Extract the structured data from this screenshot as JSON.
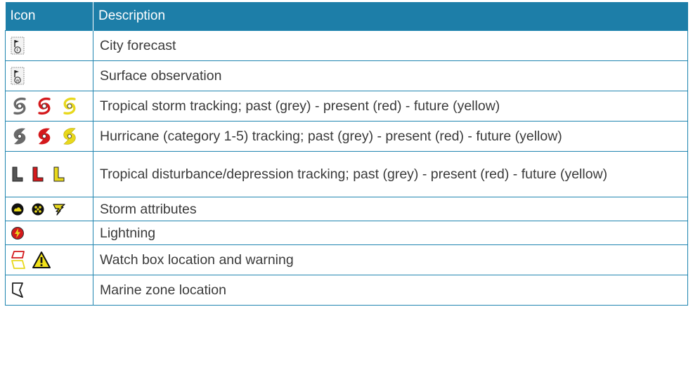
{
  "table": {
    "headers": {
      "icon": "Icon",
      "description": "Description"
    },
    "rows": [
      {
        "description": "City forecast",
        "icons": [
          "city-forecast-flag-icon"
        ]
      },
      {
        "description": "Surface observation",
        "icons": [
          "surface-observation-flag-icon"
        ]
      },
      {
        "description": "Tropical storm tracking; past (grey) - present (red) - future (yellow)",
        "icons": [
          "tropical-storm-grey-icon",
          "tropical-storm-red-icon",
          "tropical-storm-yellow-icon"
        ]
      },
      {
        "description": "Hurricane (category 1-5) tracking;  past (grey) - present (red) - future (yellow)",
        "icons": [
          "hurricane-grey-icon",
          "hurricane-red-icon",
          "hurricane-yellow-icon"
        ]
      },
      {
        "description": "Tropical disturbance/depression tracking;  past (grey) - present (red) - future (yellow)",
        "icons": [
          "depression-grey-icon",
          "depression-red-icon",
          "depression-yellow-icon"
        ]
      },
      {
        "description": "Storm attributes",
        "icons": [
          "storm-cloud-icon",
          "storm-hail-icon",
          "tornado-icon"
        ]
      },
      {
        "description": "Lightning",
        "icons": [
          "lightning-icon"
        ]
      },
      {
        "description": "Watch box location and warning",
        "icons": [
          "watch-box-icon",
          "warning-triangle-icon"
        ]
      },
      {
        "description": "Marine zone location",
        "icons": [
          "marine-zone-icon"
        ]
      }
    ]
  },
  "colors": {
    "header_bg": "#1d7ea8",
    "border": "#1f85b0",
    "past_grey": "#6a6a6a",
    "present_red": "#d4191c",
    "future_yellow": "#e8d81c"
  }
}
